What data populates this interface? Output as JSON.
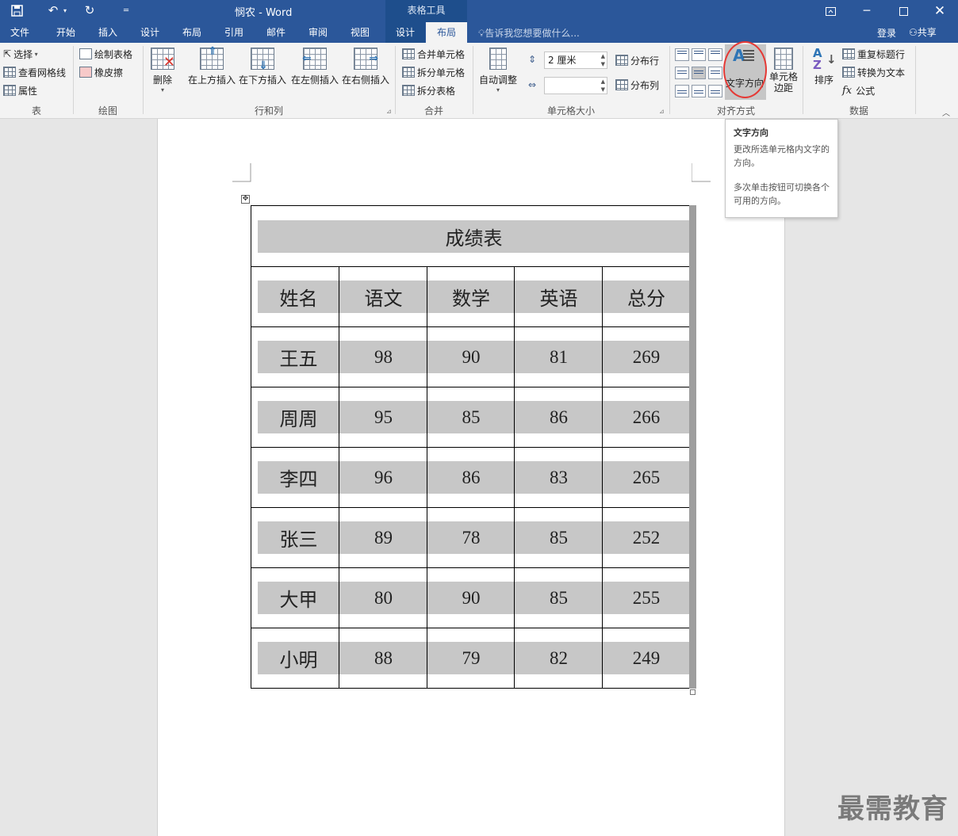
{
  "titlebar": {
    "doc_title": "悯农 - Word",
    "context_tool": "表格工具",
    "qa_icons": [
      "save-icon",
      "undo-icon",
      "redo-icon",
      "customize-icon"
    ],
    "window_icons": [
      "ribbon-display-icon",
      "minimize-icon",
      "maximize-icon",
      "close-icon"
    ]
  },
  "tabs": [
    {
      "label": "文件"
    },
    {
      "label": "开始"
    },
    {
      "label": "插入"
    },
    {
      "label": "设计"
    },
    {
      "label": "布局"
    },
    {
      "label": "引用"
    },
    {
      "label": "邮件"
    },
    {
      "label": "审阅"
    },
    {
      "label": "视图"
    },
    {
      "label": "设计"
    },
    {
      "label": "布局"
    }
  ],
  "tellme": "告诉我您想要做什么...",
  "login": "登录",
  "share": "共享",
  "ribbon": {
    "table_group": {
      "label": "表",
      "select": "选择",
      "gridlines": "查看网格线",
      "properties": "属性"
    },
    "draw_group": {
      "label": "绘图",
      "draw_table": "绘制表格",
      "eraser": "橡皮擦"
    },
    "rowcol_group": {
      "label": "行和列",
      "delete": "删除",
      "insert_above": "在上方插入",
      "insert_below": "在下方插入",
      "insert_left": "在左侧插入",
      "insert_right": "在右侧插入"
    },
    "merge_group": {
      "label": "合并",
      "merge_cells": "合并单元格",
      "split_cells": "拆分单元格",
      "split_table": "拆分表格"
    },
    "cellsize_group": {
      "label": "单元格大小",
      "autofit": "自动调整",
      "height_value": "2 厘米",
      "width_value": "",
      "distribute_rows": "分布行",
      "distribute_cols": "分布列"
    },
    "align_group": {
      "label": "对齐方式",
      "text_direction": "文字方向",
      "cell_margins": "单元格边距"
    },
    "data_group": {
      "label": "数据",
      "sort": "排序",
      "repeat_header": "重复标题行",
      "convert_text": "转换为文本",
      "formula": "公式"
    }
  },
  "tooltip": {
    "title": "文字方向",
    "line1": "更改所选单元格内文字的方向。",
    "line2": "多次单击按钮可切换各个可用的方向。"
  },
  "table": {
    "title": "成绩表",
    "headers": [
      "姓名",
      "语文",
      "数学",
      "英语",
      "总分"
    ],
    "rows": [
      [
        "王五",
        "98",
        "90",
        "81",
        "269"
      ],
      [
        "周周",
        "95",
        "85",
        "86",
        "266"
      ],
      [
        "李四",
        "96",
        "86",
        "83",
        "265"
      ],
      [
        "张三",
        "89",
        "78",
        "85",
        "252"
      ],
      [
        "大甲",
        "80",
        "90",
        "85",
        "255"
      ],
      [
        "小明",
        "88",
        "79",
        "82",
        "249"
      ]
    ]
  },
  "watermark": "最需教育",
  "colors": {
    "titlebar": "#2b579a",
    "ribbon": "#f3f3f3",
    "cell_fill": "#c7c7c7",
    "highlight_oval": "#e53935"
  }
}
